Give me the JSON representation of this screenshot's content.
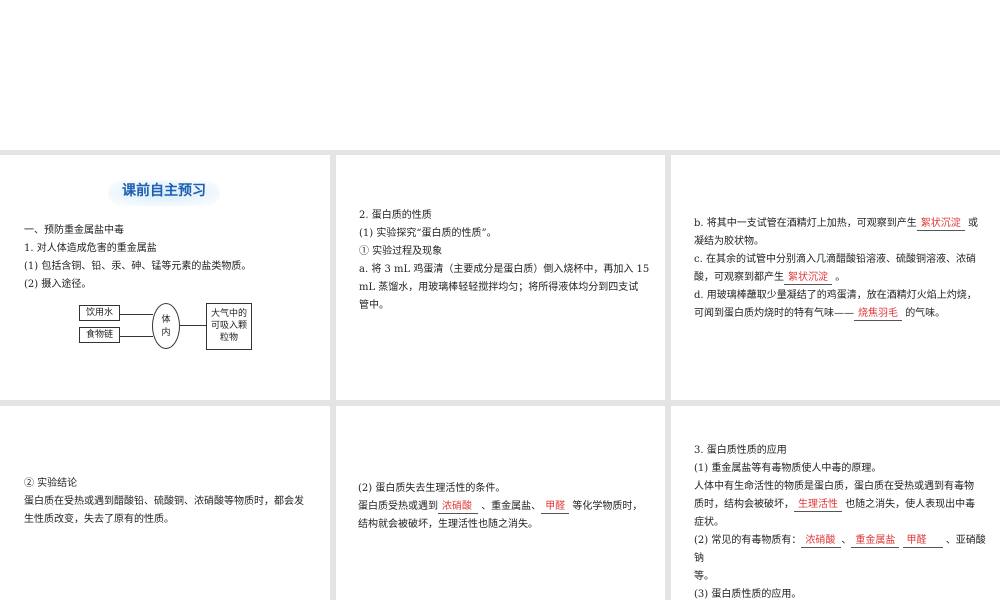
{
  "panel1": {
    "banner": "课前自主预习",
    "l1": "一、预防重金属盐中毒",
    "l2": "1. 对人体造成危害的重金属盐",
    "l3": "(1) 包括含铜、铅、汞、砷、锰等元素的盐类物质。",
    "l4": "(2) 摄入途径。",
    "diagram": {
      "water": "饮用水",
      "food": "食物链",
      "body1": "体",
      "body2": "内",
      "air1": "大气中的",
      "air2": "可吸入颗",
      "air3": "粒物"
    }
  },
  "panel2": {
    "l1": "2. 蛋白质的性质",
    "l2": "(1) 实验探究“蛋白质的性质”。",
    "l3": "① 实验过程及现象",
    "l4": "a. 将 3 mL 鸡蛋清（主要成分是蛋白质）倒入烧杯中，再加入 15",
    "l5": "mL 蒸馏水，用玻璃棒轻轻搅拌均匀；将所得液体均分到四支试",
    "l6": "管中。"
  },
  "panel3": {
    "b1": "b. 将其中一支试管在酒精灯上加热，可观察到产生",
    "b_ans": "絮状沉淀",
    "b2": "或",
    "b3": "凝结为胶状物。",
    "c1": "c. 在其余的试管中分别滴入几滴醋酸铅溶液、硫酸铜溶液、浓硝",
    "c2": "酸，可观察到都产生",
    "c_ans": "絮状沉淀",
    "c3": "。",
    "d1": "d. 用玻璃棒蘸取少量凝结了的鸡蛋清，放在酒精灯火焰上灼烧，",
    "d2": "可闻到蛋白质灼烧时的特有气味——",
    "d_ans": "烧焦羽毛",
    "d3": "的气味。"
  },
  "panel4": {
    "l1": "② 实验结论",
    "l2": "蛋白质在受热或遇到醋酸铅、硫酸铜、浓硝酸等物质时，都会发",
    "l3": "生性质改变，失去了原有的性质。"
  },
  "panel5": {
    "l1": "(2) 蛋白质失去生理活性的条件。",
    "l2a": "蛋白质受热或遇到",
    "ans1": "浓硝酸",
    "l2b": "、重金属盐、",
    "ans2": "甲醛",
    "l2c": "等化学物质时，",
    "l3": "结构就会被破坏，生理活性也随之消失。"
  },
  "panel6": {
    "l1": "3. 蛋白质性质的应用",
    "l2": "(1) 重金属盐等有毒物质使人中毒的原理。",
    "l3": "人体中有生命活性的物质是蛋白质，蛋白质在受热或遇到有毒物",
    "l4a": "质时，结构会被破坏，",
    "ans1": "生理活性",
    "l4b": "也随之消失，使人表现出中毒",
    "l5": "症状。",
    "l6a": "(2) 常见的有毒物质有：",
    "ans2": "浓硝酸",
    "sep1": "、",
    "ans3": "重金属盐",
    "ans4": "甲醛",
    "l6b": "、亚硝酸",
    "l7": "钠",
    "l8": "等。",
    "l9": "(3) 蛋白质性质的应用。"
  }
}
